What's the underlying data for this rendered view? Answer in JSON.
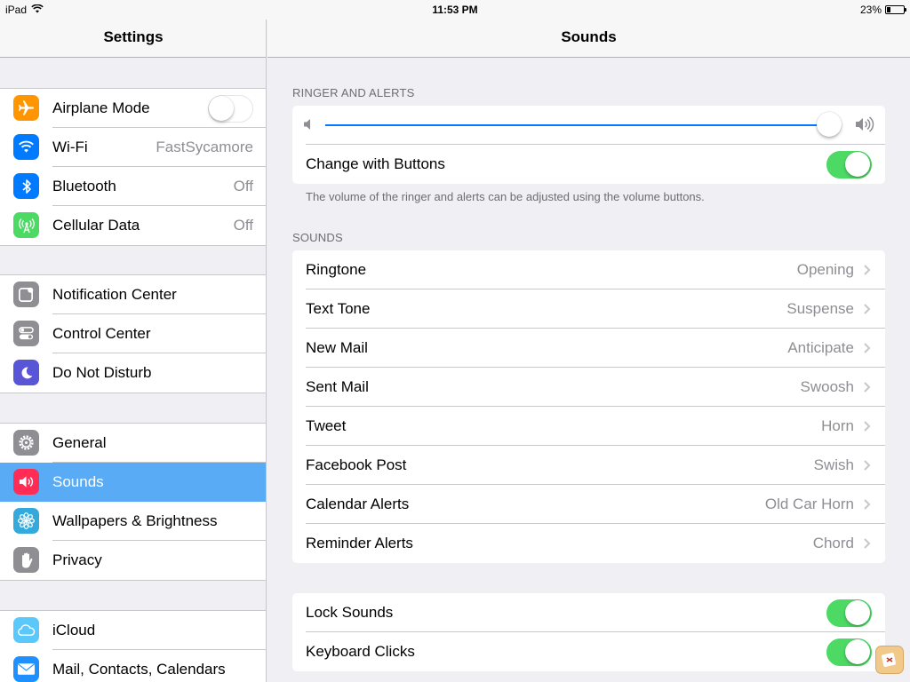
{
  "status_bar": {
    "device": "iPad",
    "time": "11:53 PM",
    "battery": "23%",
    "battery_level": 0.23
  },
  "sidebar": {
    "title": "Settings",
    "groups": [
      {
        "items": [
          {
            "label": "Airplane Mode",
            "icon": "airplane-icon",
            "color": "#ff9500",
            "toggle": false
          },
          {
            "label": "Wi-Fi",
            "icon": "wifi-icon",
            "color": "#007aff",
            "value": "FastSycamore"
          },
          {
            "label": "Bluetooth",
            "icon": "bluetooth-icon",
            "color": "#007aff",
            "value": "Off"
          },
          {
            "label": "Cellular Data",
            "icon": "cellular-icon",
            "color": "#4cd964",
            "value": "Off"
          }
        ]
      },
      {
        "items": [
          {
            "label": "Notification Center",
            "icon": "notification-icon",
            "color": "#8e8e93"
          },
          {
            "label": "Control Center",
            "icon": "control-center-icon",
            "color": "#8e8e93"
          },
          {
            "label": "Do Not Disturb",
            "icon": "moon-icon",
            "color": "#5856d6"
          }
        ]
      },
      {
        "items": [
          {
            "label": "General",
            "icon": "gear-icon",
            "color": "#8e8e93"
          },
          {
            "label": "Sounds",
            "icon": "speaker-icon",
            "color": "#ff2d55",
            "selected": true
          },
          {
            "label": "Wallpapers & Brightness",
            "icon": "flower-icon",
            "color": "#34aadc"
          },
          {
            "label": "Privacy",
            "icon": "hand-icon",
            "color": "#8e8e93"
          }
        ]
      },
      {
        "items": [
          {
            "label": "iCloud",
            "icon": "cloud-icon",
            "color": "#5ac8fa"
          },
          {
            "label": "Mail, Contacts, Calendars",
            "icon": "mail-icon",
            "color": "#1e90ff"
          }
        ]
      }
    ]
  },
  "main": {
    "title": "Sounds",
    "ringer": {
      "header": "RINGER AND ALERTS",
      "volume_level": 1.0,
      "change_with_buttons_label": "Change with Buttons",
      "change_with_buttons": true,
      "footer": "The volume of the ringer and alerts can be adjusted using the volume buttons."
    },
    "sounds": {
      "header": "SOUNDS",
      "items": [
        {
          "label": "Ringtone",
          "value": "Opening"
        },
        {
          "label": "Text Tone",
          "value": "Suspense"
        },
        {
          "label": "New Mail",
          "value": "Anticipate"
        },
        {
          "label": "Sent Mail",
          "value": "Swoosh"
        },
        {
          "label": "Tweet",
          "value": "Horn"
        },
        {
          "label": "Facebook Post",
          "value": "Swish"
        },
        {
          "label": "Calendar Alerts",
          "value": "Old Car Horn"
        },
        {
          "label": "Reminder Alerts",
          "value": "Chord"
        }
      ]
    },
    "system": {
      "items": [
        {
          "label": "Lock Sounds",
          "toggle": true
        },
        {
          "label": "Keyboard Clicks",
          "toggle": true
        }
      ]
    }
  },
  "colors": {
    "accent": "#007aff",
    "toggle_on": "#4cd964",
    "selected_row": "#5aabf5"
  }
}
